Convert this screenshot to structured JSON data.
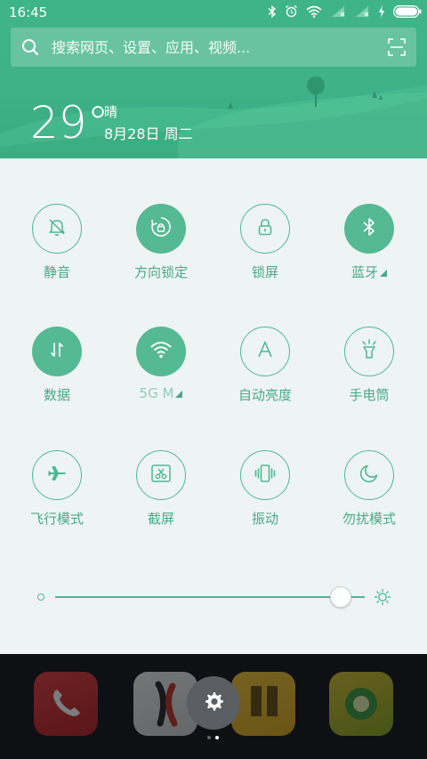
{
  "status_bar": {
    "time": "16:45",
    "icons": [
      "bluetooth-icon",
      "alarm-icon",
      "wifi-icon",
      "signal-1-icon",
      "signal-2-icon",
      "charging-icon",
      "battery-icon"
    ]
  },
  "search": {
    "placeholder": "搜索网页、设置、应用、视频..."
  },
  "weather": {
    "temperature": "29°",
    "condition": "晴",
    "date": "8月28日 周二"
  },
  "toggles": [
    {
      "label": "静音",
      "active": false,
      "icon": "bell-mute-icon"
    },
    {
      "label": "方向锁定",
      "active": true,
      "icon": "rotation-lock-icon"
    },
    {
      "label": "锁屏",
      "active": false,
      "icon": "lock-icon"
    },
    {
      "label": "蓝牙",
      "active": true,
      "icon": "bluetooth-icon",
      "has_arrow": true
    },
    {
      "label": "数据",
      "active": true,
      "icon": "mobile-data-icon"
    },
    {
      "label": "5G    M",
      "active": true,
      "icon": "wifi-icon",
      "has_arrow": true
    },
    {
      "label": "自动亮度",
      "active": false,
      "icon": "auto-brightness-icon"
    },
    {
      "label": "手电筒",
      "active": false,
      "icon": "flashlight-icon"
    },
    {
      "label": "飞行模式",
      "active": false,
      "icon": "airplane-icon"
    },
    {
      "label": "截屏",
      "active": false,
      "icon": "screenshot-icon"
    },
    {
      "label": "振动",
      "active": false,
      "icon": "vibrate-icon"
    },
    {
      "label": "勿扰模式",
      "active": false,
      "icon": "moon-icon"
    }
  ],
  "brightness": {
    "level": 0.92
  },
  "colors": {
    "accent": "#4fb893",
    "header": "#3fb48a",
    "panel_bg": "#eef4f3"
  },
  "dock": {
    "apps": [
      "phone-app",
      "koi-app",
      "sms-app",
      "green-app"
    ],
    "pager_active": 1
  }
}
